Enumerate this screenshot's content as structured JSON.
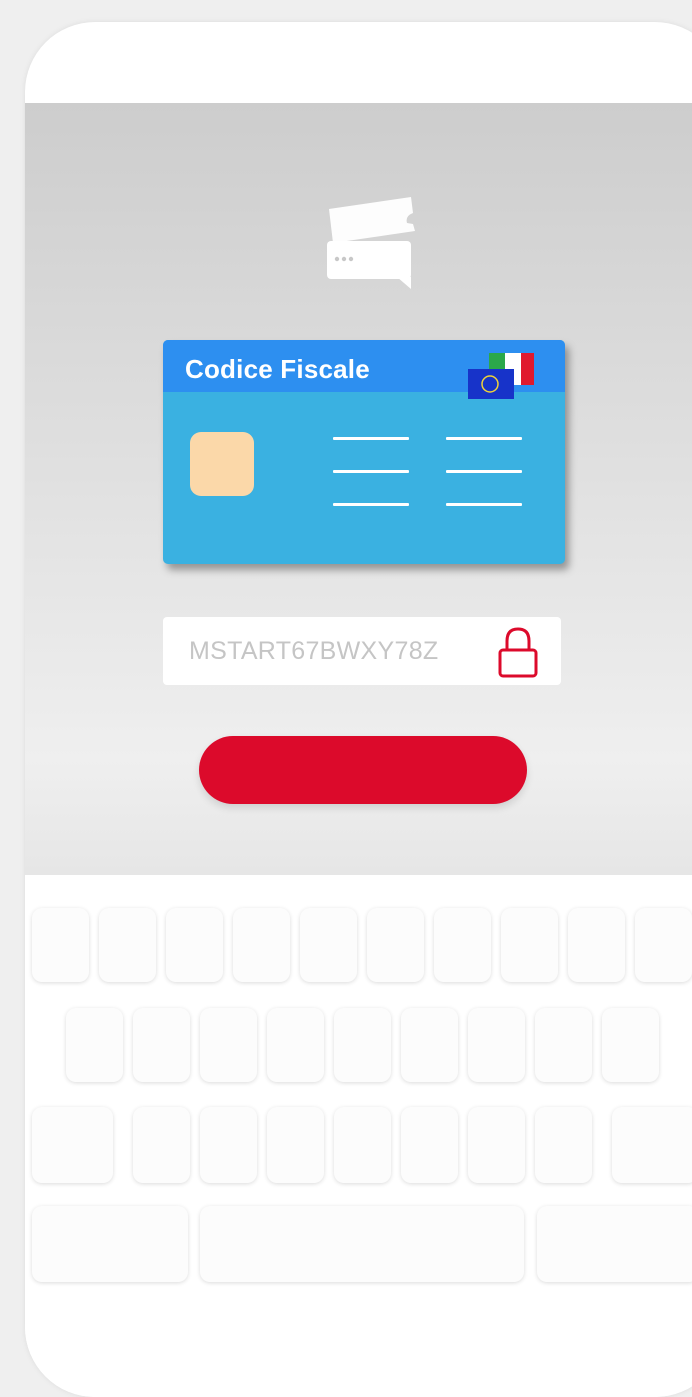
{
  "card": {
    "title": "Codice Fiscale"
  },
  "fiscal_code_field": {
    "value": "MSTART67BWXY78Z"
  },
  "submit_button": {
    "label": ""
  },
  "colors": {
    "accent_red": "#dc0a2b",
    "card_blue": "#3ab1e1",
    "card_header_blue": "#2d8ff0",
    "chip": "#fbd8a9"
  },
  "icons": [
    "chat-ticket-icon",
    "eu-italy-flag-icon",
    "lock-icon"
  ],
  "keyboard": {
    "label": ""
  }
}
